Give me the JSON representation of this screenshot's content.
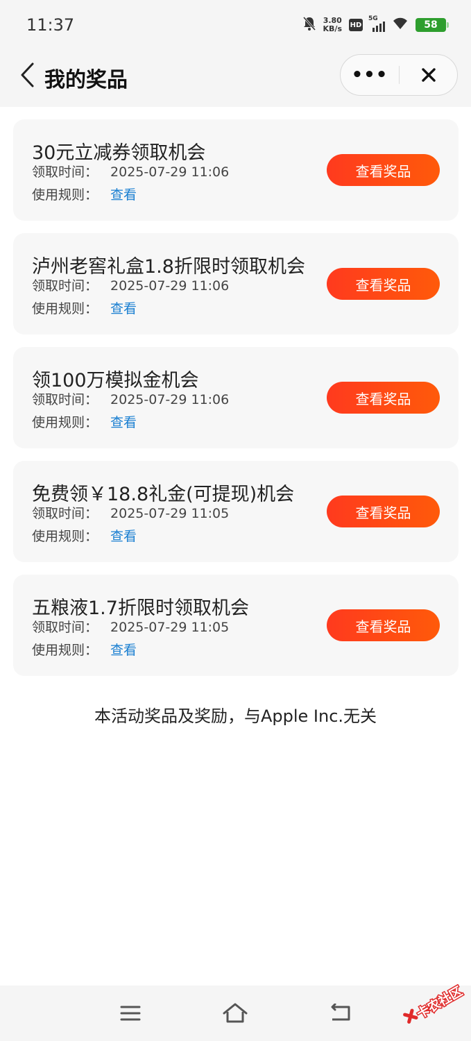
{
  "status_bar": {
    "time": "11:37",
    "net_speed_value": "3.80",
    "net_speed_unit": "KB/s",
    "hd_label": "HD",
    "signal_label": "5G",
    "battery": "58"
  },
  "nav": {
    "title": "我的奖品",
    "more_label": "•••"
  },
  "labels": {
    "time_label": "领取时间：",
    "rule_label": "使用规则：",
    "rule_link": "查看",
    "button_label": "查看奖品"
  },
  "prizes": [
    {
      "title": "30元立减券领取机会",
      "time": "2025-07-29 11:06"
    },
    {
      "title": "泸州老窖礼盒1.8折限时领取机会",
      "time": "2025-07-29 11:06"
    },
    {
      "title": "领100万模拟金机会",
      "time": "2025-07-29 11:06"
    },
    {
      "title": "免费领￥18.8礼金(可提现)机会",
      "time": "2025-07-29 11:05"
    },
    {
      "title": "五粮液1.7折限时领取机会",
      "time": "2025-07-29 11:05"
    }
  ],
  "disclaimer": "本活动奖品及奖励，与Apple Inc.无关",
  "watermark": "卡农社区",
  "colors": {
    "accent_button": "#ff3a1e",
    "link": "#1a7fd1",
    "battery": "#2e9e2e"
  }
}
